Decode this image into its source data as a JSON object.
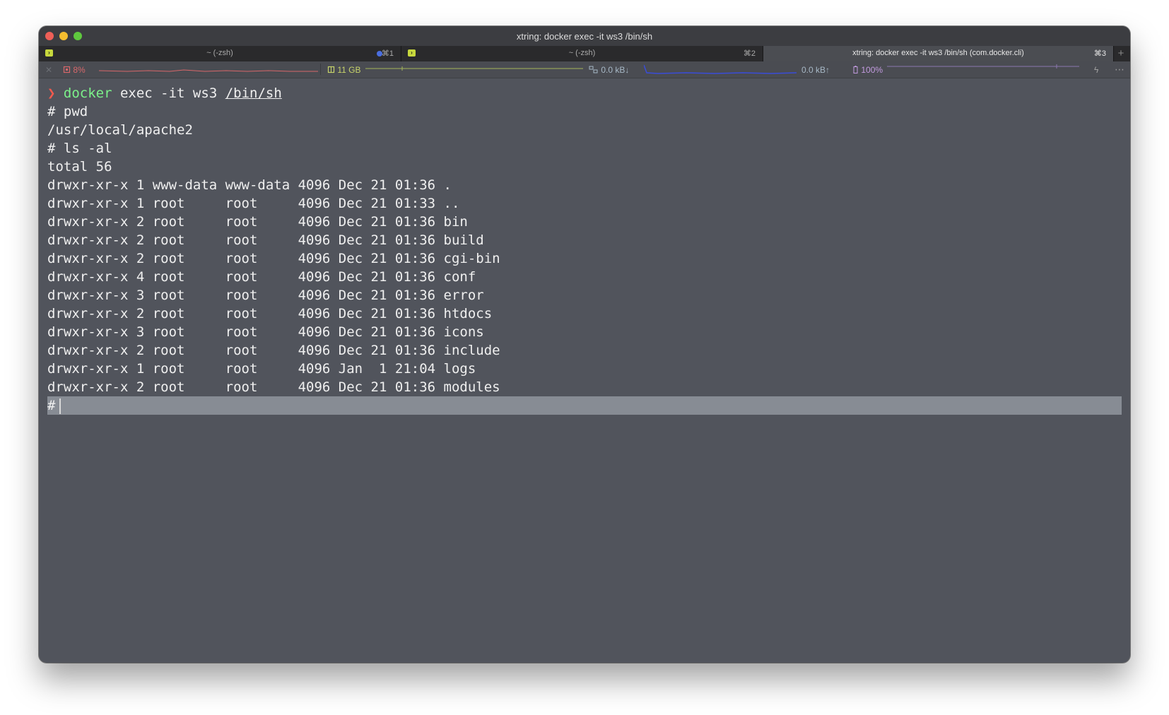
{
  "window": {
    "title": "xtring: docker exec -it ws3 /bin/sh"
  },
  "tabs": [
    {
      "label": "~ (-zsh)",
      "shortcut": "⌘1",
      "has_icon": true,
      "has_dot": true,
      "active": false
    },
    {
      "label": "~ (-zsh)",
      "shortcut": "⌘2",
      "has_icon": true,
      "has_dot": false,
      "active": false
    },
    {
      "label": "xtring: docker exec -it ws3 /bin/sh (com.docker.cli)",
      "shortcut": "⌘3",
      "has_icon": false,
      "has_dot": false,
      "active": true
    }
  ],
  "tab_add_label": "+",
  "status": {
    "close_glyph": "✕",
    "cpu": "8%",
    "memory": "11 GB",
    "net_down": "0.0 kB↓",
    "net_up": "0.0 kB↑",
    "battery": "100%",
    "bolt": "ϟ",
    "more_glyph": "⋯"
  },
  "terminal": {
    "prompt_arrow": "❯",
    "first_command": {
      "cmd": "docker",
      "args": " exec -it ws3 ",
      "path": "/bin/sh"
    },
    "lines": [
      "# pwd",
      "/usr/local/apache2",
      "# ls -al",
      "total 56",
      "drwxr-xr-x 1 www-data www-data 4096 Dec 21 01:36 .",
      "drwxr-xr-x 1 root     root     4096 Dec 21 01:33 ..",
      "drwxr-xr-x 2 root     root     4096 Dec 21 01:36 bin",
      "drwxr-xr-x 2 root     root     4096 Dec 21 01:36 build",
      "drwxr-xr-x 2 root     root     4096 Dec 21 01:36 cgi-bin",
      "drwxr-xr-x 4 root     root     4096 Dec 21 01:36 conf",
      "drwxr-xr-x 3 root     root     4096 Dec 21 01:36 error",
      "drwxr-xr-x 2 root     root     4096 Dec 21 01:36 htdocs",
      "drwxr-xr-x 3 root     root     4096 Dec 21 01:36 icons",
      "drwxr-xr-x 2 root     root     4096 Dec 21 01:36 include",
      "drwxr-xr-x 1 root     root     4096 Jan  1 21:04 logs",
      "drwxr-xr-x 2 root     root     4096 Dec 21 01:36 modules"
    ],
    "current_prompt": "#"
  }
}
